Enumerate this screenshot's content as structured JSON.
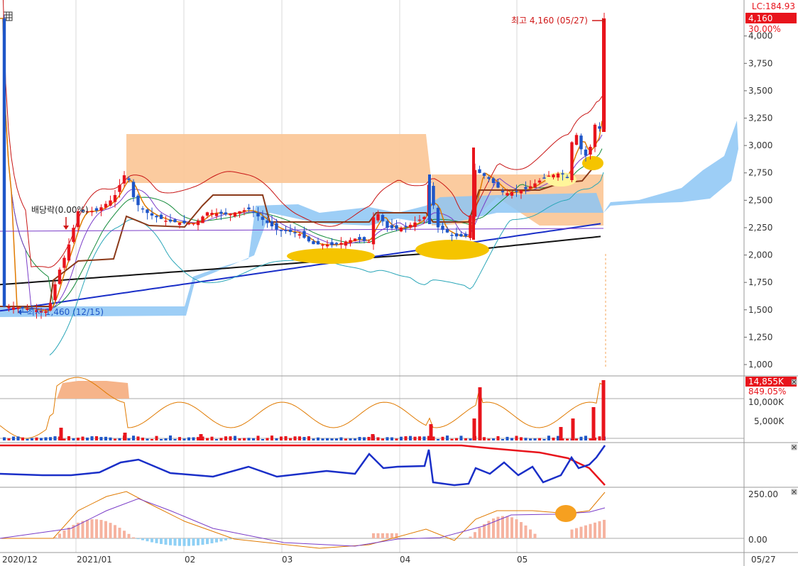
{
  "toolbar": {
    "settings_icon": "grid-settings-icon"
  },
  "colors": {
    "up": "#e8141c",
    "down": "#1e56c8",
    "cloud_bear": "#ff9f4a",
    "cloud_bull": "#6fb8f5",
    "ma5": "#e07a00",
    "ma20": "#7a3cc8",
    "ma60": "#138a3a",
    "ma120": "#1a2fc8",
    "ma240": "#111111",
    "bollinger": "#c81414",
    "envelope": "#2aa6b8",
    "baseline": "#8b3a1a",
    "highlight": "#f5c400"
  },
  "main": {
    "lc_label": "LC:184.93",
    "last_price_box": "4,160",
    "change_pct": "30.00%",
    "high_annotation": "최고 4,160 (05/27)",
    "low_annotation": "최저 1,460 (12/15)",
    "dividend_annotation": "배당락(0.00%)",
    "y_ticks": [
      "4,000",
      "3,750",
      "3,500",
      "3,250",
      "3,000",
      "2,750",
      "2,500",
      "2,250",
      "2,000",
      "1,750",
      "1,500",
      "1,250",
      "1,000"
    ]
  },
  "volume": {
    "last_box": "14,855K",
    "pct": "849.05%",
    "ticks": [
      "10,000K",
      "5,000K"
    ]
  },
  "indicator": {
    "close_icon": "close-icon"
  },
  "macd": {
    "ticks": [
      "250.00",
      "0.00"
    ]
  },
  "x_axis": {
    "labels": [
      "2020/12",
      "2021/01",
      "02",
      "03",
      "04",
      "05"
    ],
    "last_date": "05/27"
  },
  "chart_data": {
    "type": "candlestick",
    "x": [
      "2020-12-01",
      "2020-12-31"
    ],
    "price_axis": {
      "ylim": [
        1000,
        4160
      ],
      "unit": "KRW"
    },
    "high": {
      "value": 4160,
      "date": "05/27"
    },
    "low": {
      "value": 1460,
      "date": "12/15"
    },
    "last_close": 4160,
    "volume_last_k": 14855,
    "volume_axis": {
      "ticks_k": [
        5000,
        10000
      ]
    },
    "macd_axis": {
      "ticks": [
        0,
        250
      ]
    }
  }
}
